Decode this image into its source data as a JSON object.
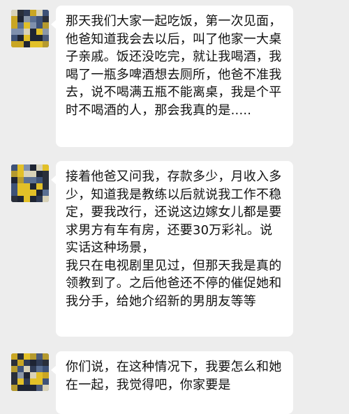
{
  "messages": [
    {
      "avatar": "pixelated-avatar",
      "text": "那天我们大家一起吃饭，第一次见面，他爸知道我会去以后，叫了他家一大桌子亲戚。饭还没吃完，就让我喝酒，我喝了一瓶多啤酒想去厕所，他爸不准我去，说不喝满五瓶不能离桌，我是个平时不喝酒的人，那会我真的是....."
    },
    {
      "avatar": "pixelated-avatar",
      "text": "接着他爸又问我，存款多少，月收入多少，知道我是教练以后就说我工作不稳定，要我改行，还说这边嫁女儿都是要求男方有车有房，还要30万彩礼。说实话这种场景，\n我只在电视剧里见过，但那天我是真的领教到了。之后他爸还不停的催促她和我分手，给她介绍新的男朋友等等"
    },
    {
      "avatar": "pixelated-avatar",
      "text": "你们说，在这种情况下，我要怎么和她在一起，我觉得吧，你家要是"
    }
  ]
}
